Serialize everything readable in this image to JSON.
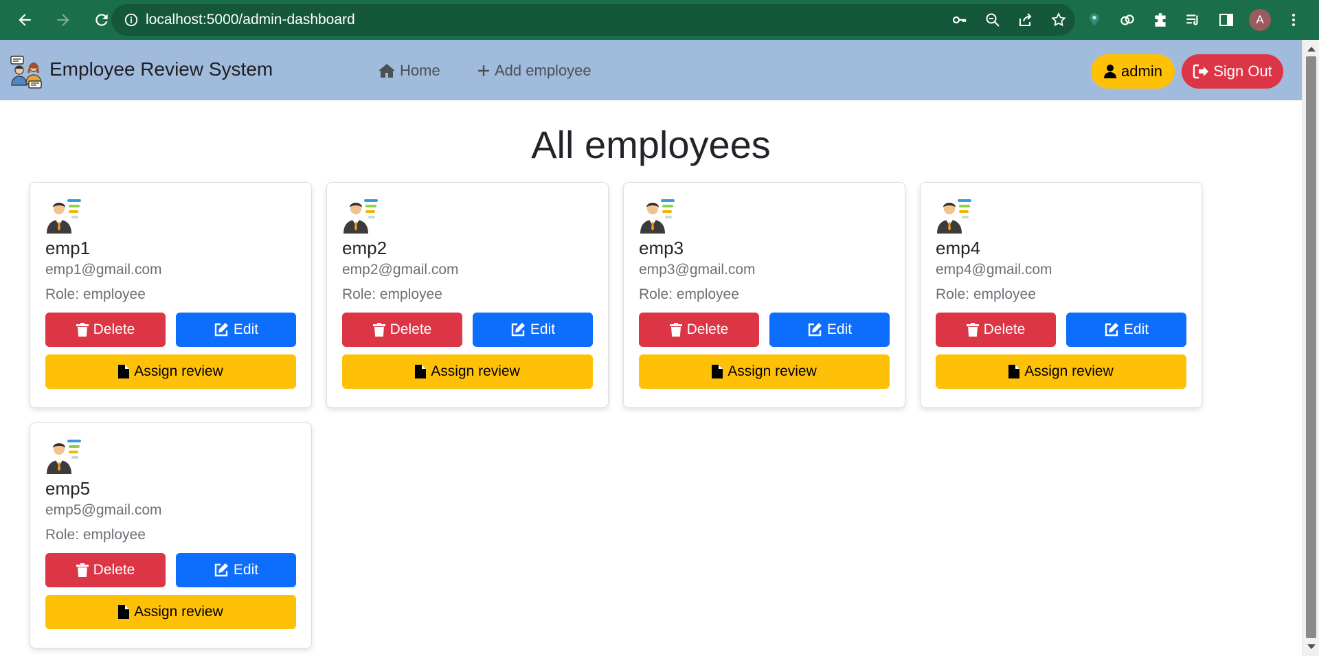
{
  "browser": {
    "url": "localhost:5000/admin-dashboard",
    "profile_initial": "A"
  },
  "app": {
    "brand_name": "Employee Review System",
    "nav": {
      "home_label": "Home",
      "add_employee_label": "Add employee"
    },
    "user_label": "admin",
    "sign_out_label": "Sign Out"
  },
  "main": {
    "title": "All employees",
    "employees": [
      {
        "name": "emp1",
        "email": "emp1@gmail.com",
        "role": "Role: employee"
      },
      {
        "name": "emp2",
        "email": "emp2@gmail.com",
        "role": "Role: employee"
      },
      {
        "name": "emp3",
        "email": "emp3@gmail.com",
        "role": "Role: employee"
      },
      {
        "name": "emp4",
        "email": "emp4@gmail.com",
        "role": "Role: employee"
      },
      {
        "name": "emp5",
        "email": "emp5@gmail.com",
        "role": "Role: employee"
      }
    ],
    "card_buttons": {
      "delete_label": "Delete",
      "edit_label": "Edit",
      "assign_label": "Assign review"
    }
  },
  "colors": {
    "browser_bar": "#1b6e4a",
    "navbar": "#a0bbdc",
    "danger": "#dc3545",
    "primary": "#0d6efd",
    "warning": "#ffc107"
  },
  "icons": [
    "back-arrow-icon",
    "forward-arrow-icon",
    "reload-icon",
    "info-icon",
    "key-icon",
    "zoom-out-icon",
    "share-icon",
    "star-icon",
    "extension-icon",
    "puzzle-icon",
    "reading-list-icon",
    "side-panel-icon",
    "menu-dots-icon",
    "home-icon",
    "plus-icon",
    "user-icon",
    "sign-out-icon",
    "trash-icon",
    "edit-icon",
    "file-icon"
  ]
}
